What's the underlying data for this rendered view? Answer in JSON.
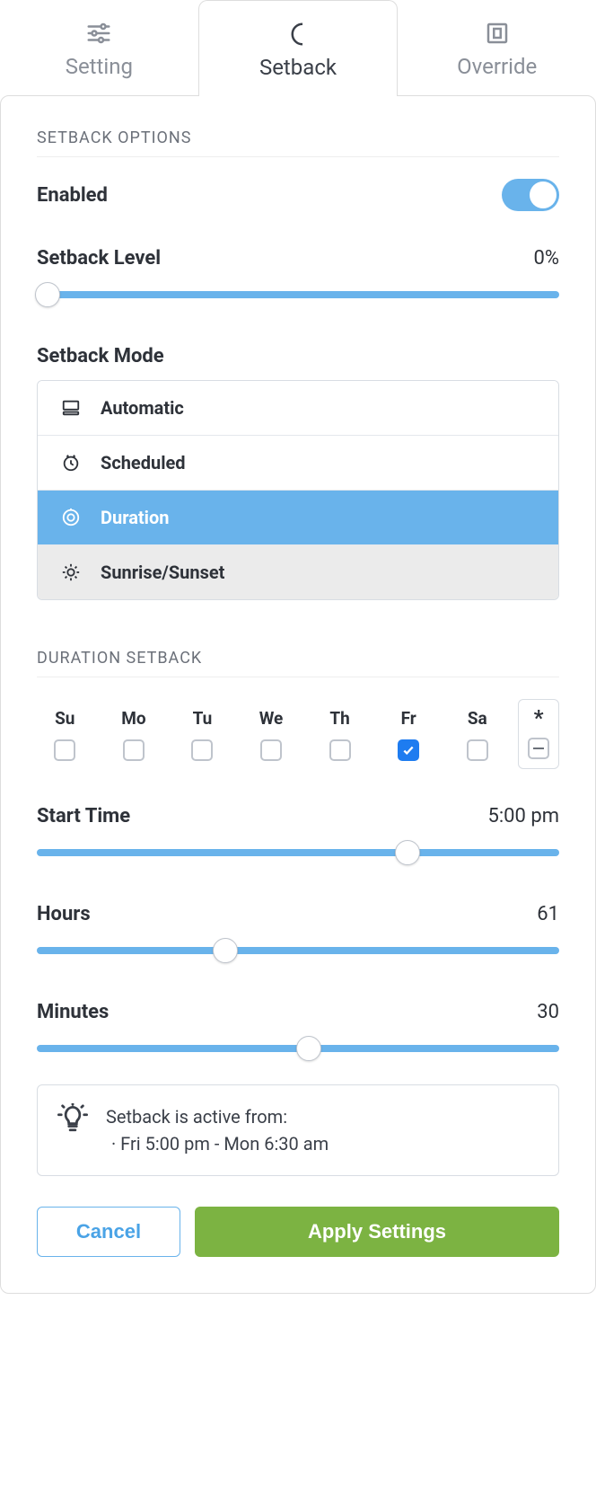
{
  "tabs": {
    "setting": "Setting",
    "setback": "Setback",
    "override": "Override"
  },
  "section1_title": "SETBACK OPTIONS",
  "enabled": {
    "label": "Enabled",
    "value": true
  },
  "level": {
    "label": "Setback Level",
    "value_text": "0%",
    "percent": 0
  },
  "mode": {
    "title": "Setback Mode",
    "automatic": "Automatic",
    "scheduled": "Scheduled",
    "duration": "Duration",
    "sunrise": "Sunrise/Sunset",
    "selected": "duration"
  },
  "section2_title": "DURATION SETBACK",
  "days": {
    "su": {
      "label": "Su",
      "checked": false
    },
    "mo": {
      "label": "Mo",
      "checked": false
    },
    "tu": {
      "label": "Tu",
      "checked": false
    },
    "we": {
      "label": "We",
      "checked": false
    },
    "th": {
      "label": "Th",
      "checked": false
    },
    "fr": {
      "label": "Fr",
      "checked": true
    },
    "sa": {
      "label": "Sa",
      "checked": false
    },
    "all_label": "*",
    "all_state": "mixed"
  },
  "start_time": {
    "label": "Start Time",
    "value_text": "5:00 pm",
    "percent": 71
  },
  "hours": {
    "label": "Hours",
    "value_text": "61",
    "percent": 36
  },
  "minutes": {
    "label": "Minutes",
    "value_text": "30",
    "percent": 52
  },
  "info": {
    "line1": "Setback is active from:",
    "line2": "· Fri 5:00 pm - Mon 6:30 am"
  },
  "buttons": {
    "cancel": "Cancel",
    "apply": "Apply Settings"
  }
}
